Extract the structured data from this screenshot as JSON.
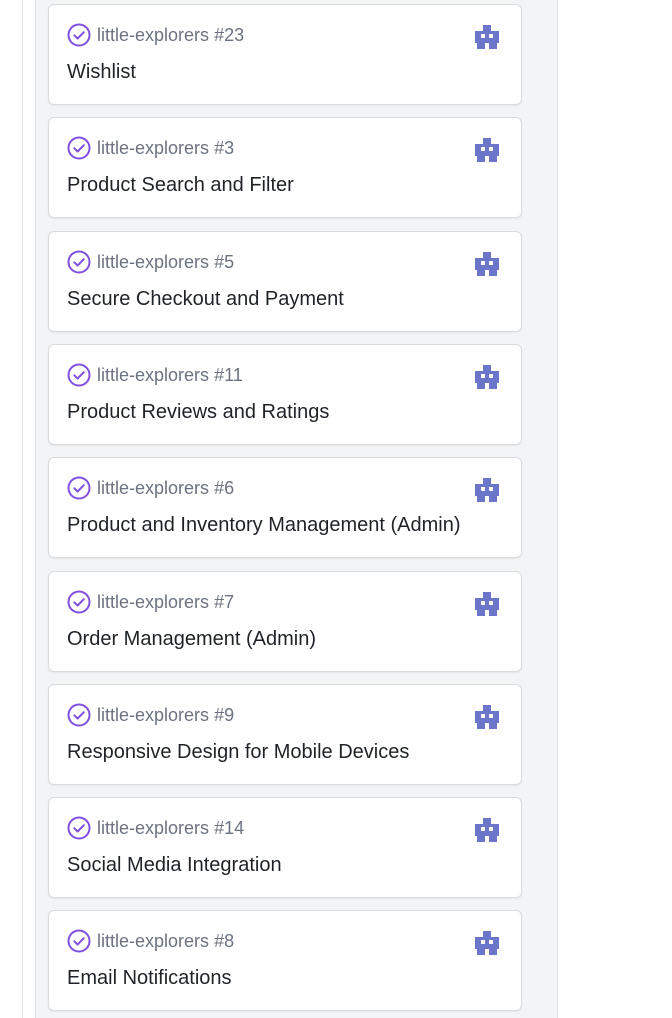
{
  "board": {
    "cards": [
      {
        "repo": "little-explorers",
        "number": "#23",
        "title": "Wishlist",
        "status": "closed-completed",
        "avatar": "bot-avatar"
      },
      {
        "repo": "little-explorers",
        "number": "#3",
        "title": "Product Search and Filter",
        "status": "closed-completed",
        "avatar": "bot-avatar"
      },
      {
        "repo": "little-explorers",
        "number": "#5",
        "title": "Secure Checkout and Payment",
        "status": "closed-completed",
        "avatar": "bot-avatar"
      },
      {
        "repo": "little-explorers",
        "number": "#11",
        "title": "Product Reviews and Ratings",
        "status": "closed-completed",
        "avatar": "bot-avatar"
      },
      {
        "repo": "little-explorers",
        "number": "#6",
        "title": "Product and Inventory Management (Admin)",
        "status": "closed-completed",
        "avatar": "bot-avatar"
      },
      {
        "repo": "little-explorers",
        "number": "#7",
        "title": "Order Management (Admin)",
        "status": "closed-completed",
        "avatar": "bot-avatar"
      },
      {
        "repo": "little-explorers",
        "number": "#9",
        "title": "Responsive Design for Mobile Devices",
        "status": "closed-completed",
        "avatar": "bot-avatar"
      },
      {
        "repo": "little-explorers",
        "number": "#14",
        "title": "Social Media Integration",
        "status": "closed-completed",
        "avatar": "bot-avatar"
      },
      {
        "repo": "little-explorers",
        "number": "#8",
        "title": "Email Notifications",
        "status": "closed-completed",
        "avatar": "bot-avatar"
      }
    ]
  },
  "colors": {
    "status_completed": "#8250df",
    "avatar": "#6b75c9",
    "title_text": "#1f2328",
    "meta_text": "#6b7280"
  },
  "icons": {
    "status": "check-circle-icon",
    "avatar": "bot-avatar-icon"
  }
}
